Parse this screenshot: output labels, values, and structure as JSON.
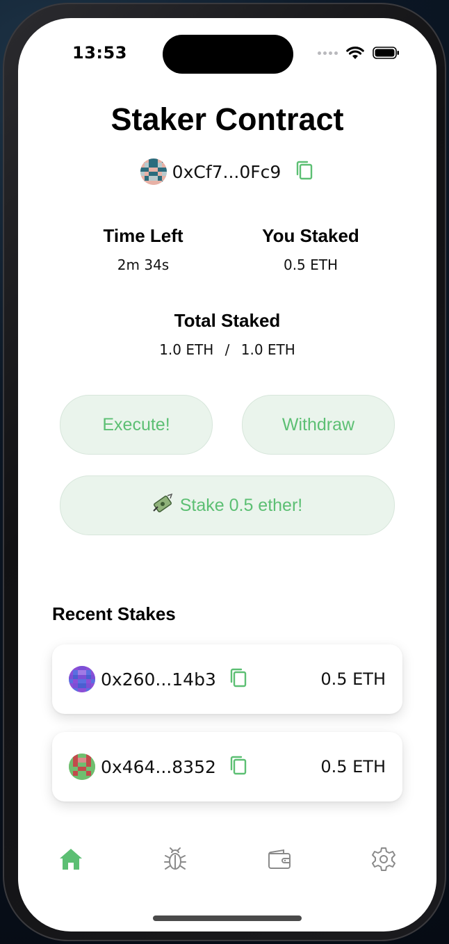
{
  "status_bar": {
    "time": "13:53"
  },
  "header": {
    "title": "Staker Contract",
    "contract_address": "0xCf7...0Fc9"
  },
  "stats": {
    "time_left_label": "Time Left",
    "time_left_value": "2m 34s",
    "you_staked_label": "You Staked",
    "you_staked_value": "0.5 ETH",
    "total_staked_label": "Total Staked",
    "total_staked_value": "1.0 ETH",
    "separator": "/",
    "threshold_value": "1.0 ETH"
  },
  "actions": {
    "execute_label": "Execute!",
    "withdraw_label": "Withdraw",
    "stake_label": "Stake 0.5 ether!"
  },
  "recent": {
    "title": "Recent Stakes",
    "items": [
      {
        "address": "0x260...14b3",
        "amount": "0.5 ETH"
      },
      {
        "address": "0x464...8352",
        "amount": "0.5 ETH"
      }
    ]
  },
  "tab_bar": {
    "items": [
      "home-icon",
      "bug-icon",
      "wallet-icon",
      "gear-icon"
    ],
    "active": "home-icon"
  },
  "colors": {
    "accent": "#5cbf73",
    "button_bg": "#eaf4ec",
    "inactive_icon": "#8a8a8a"
  }
}
